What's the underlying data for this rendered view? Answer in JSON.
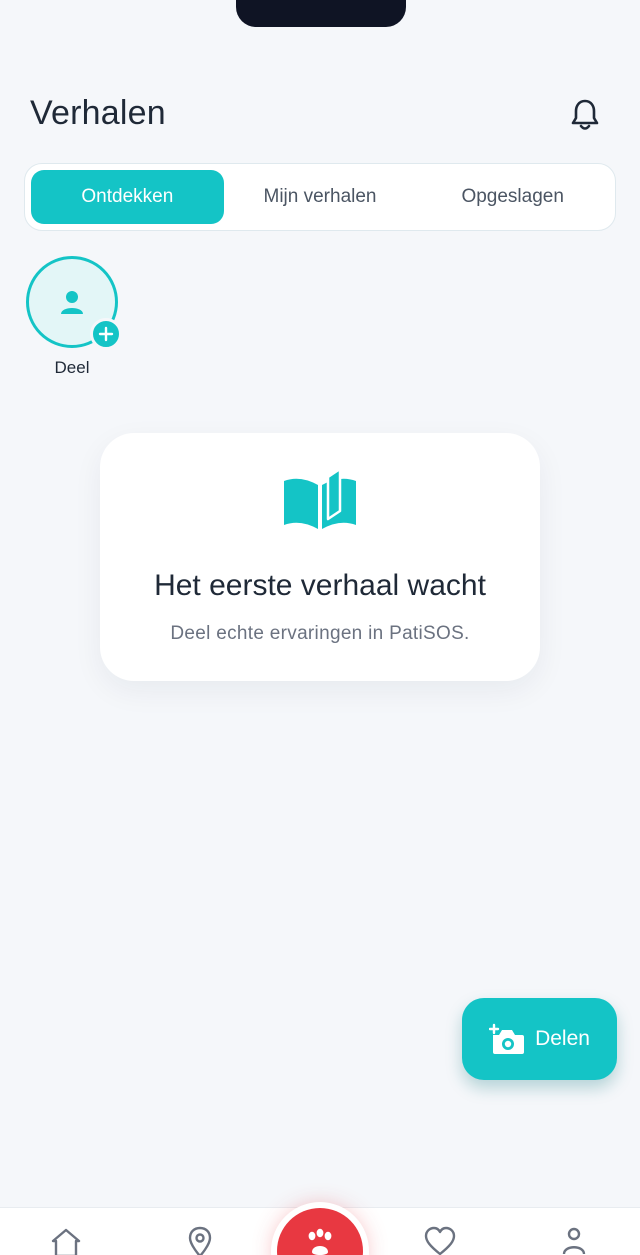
{
  "header": {
    "title": "Verhalen"
  },
  "tabs": [
    {
      "label": "Ontdekken",
      "active": true
    },
    {
      "label": "Mijn verhalen",
      "active": false
    },
    {
      "label": "Opgeslagen",
      "active": false
    }
  ],
  "share_story": {
    "label": "Deel"
  },
  "empty_state": {
    "title": "Het eerste verhaal wacht",
    "subtitle": "Deel echte ervaringen in PatiSOS."
  },
  "fab": {
    "label": "Delen"
  },
  "bottom_nav": {
    "items": [
      "home-icon",
      "location-icon",
      "paw-icon",
      "heart-icon",
      "profile-icon"
    ]
  },
  "colors": {
    "accent": "#14c4c6",
    "center_button": "#e83841",
    "background": "#f5f7fa"
  }
}
